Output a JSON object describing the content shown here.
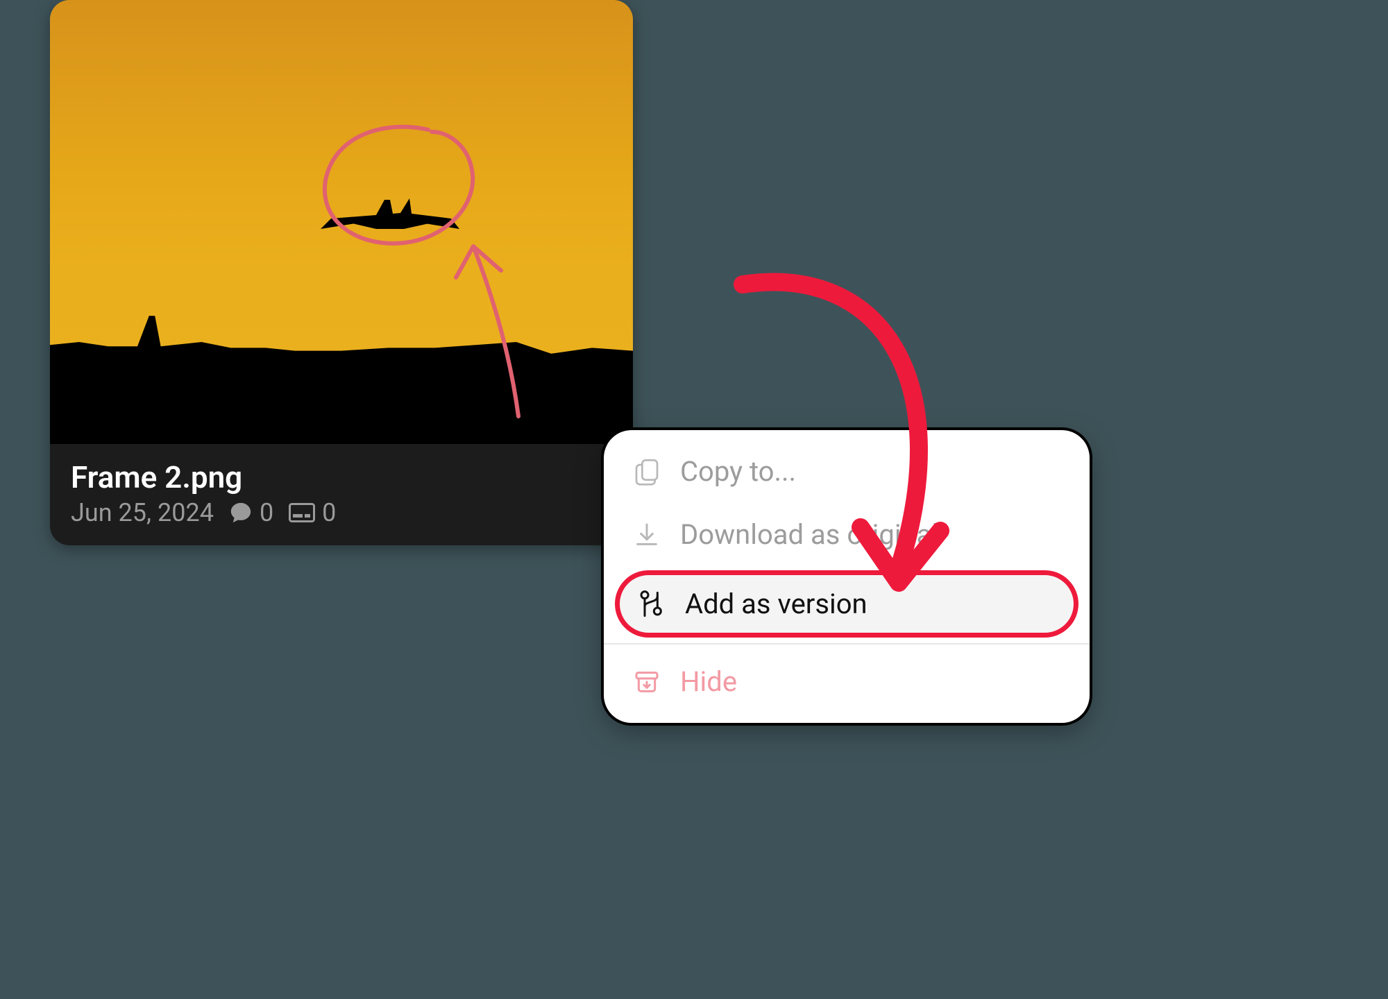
{
  "card": {
    "file_name": "Frame 2.png",
    "date": "Jun 25, 2024",
    "comments": "0",
    "tasks": "0"
  },
  "menu": {
    "copy_to": "Copy to...",
    "download_original": "Download as original",
    "add_as_version": "Add as version",
    "hide": "Hide"
  },
  "colors": {
    "annotation_red": "#ee1a3c",
    "annotation_pink": "#e06270"
  }
}
